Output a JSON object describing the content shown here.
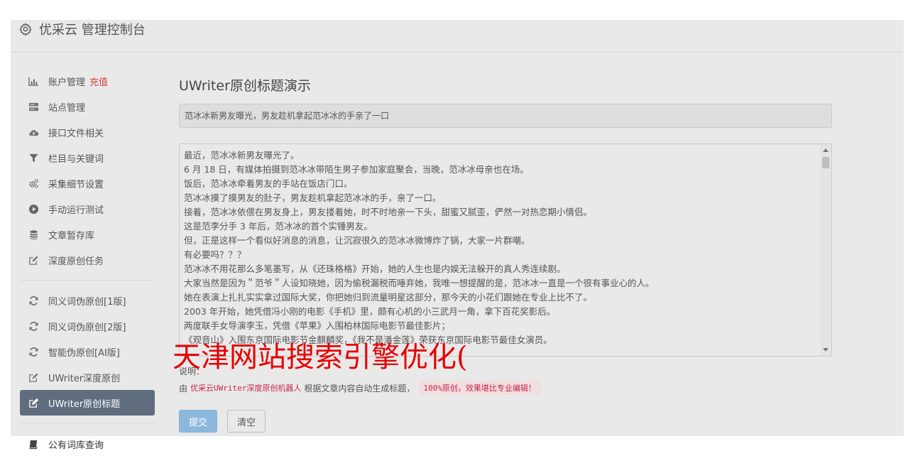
{
  "app": {
    "title": "优采云 管理控制台"
  },
  "sidebar": {
    "items": [
      {
        "label": "账户管理",
        "badge": "充值",
        "icon": "bar-chart-icon"
      },
      {
        "label": "站点管理",
        "icon": "server-icon"
      },
      {
        "label": "接口文件相关",
        "icon": "cloud-upload-icon"
      },
      {
        "label": "栏目与关键词",
        "icon": "filter-icon"
      },
      {
        "label": "采集细节设置",
        "icon": "gears-icon"
      },
      {
        "label": "手动运行测试",
        "icon": "play-circle-icon"
      },
      {
        "label": "文章暂存库",
        "icon": "database-icon"
      },
      {
        "label": "深度原创任务",
        "icon": "edit-icon"
      }
    ],
    "items2": [
      {
        "label": "同义词伪原创[1版]",
        "icon": "refresh-icon"
      },
      {
        "label": "同义词伪原创[2版]",
        "icon": "refresh-icon"
      },
      {
        "label": "智能伪原创[AI版]",
        "icon": "refresh-icon"
      },
      {
        "label": "UWriter深度原创",
        "icon": "edit-icon"
      },
      {
        "label": "UWriter原创标题",
        "icon": "edit-icon",
        "active": true
      }
    ],
    "below": {
      "label": "公有词库查询",
      "icon": "book-icon"
    }
  },
  "main": {
    "title": "UWriter原创标题演示",
    "title_input_value": "范冰冰新男友曝光，男友趁机拿起范冰冰的手亲了一口",
    "article_lines": [
      "最近，范冰冰新男友曝光了。",
      "6 月 18 日，有媒体拍摄到范冰冰带陌生男子参加家庭聚会，当晚，范冰冰母亲也在场。",
      "饭后，范冰冰牵着男友的手站在饭店门口。",
      "范冰冰摸了摸男友的肚子，男友趁机拿起范冰冰的手，亲了一口。",
      "接着，范冰冰依偎在男友身上，男友搂着她，时不时地亲一下头，甜蜜又腻歪，俨然一对热恋期小情侣。",
      "这是范李分手 3 年后，范冰冰的首个实锤男友。",
      "但，正是这样一个看似好消息的消息，让沉寂很久的范冰冰微博炸了锅，大家一片群嘲。",
      "有必要吗？？？",
      "范冰冰不用花那么多笔墨写，从《还珠格格》开始，她的人生也是内娱无法躲开的真人秀连续剧。",
      "大家当然是因为＂范爷＂人设知晓她，因为偷税漏税而唾弃她，我唯一想提醒的是，范冰冰一直是一个很有事业心的人。",
      "她在表演上扎扎实实拿过国际大奖，你把她归到流量明星这部分，那今天的小花们跟她在专业上比不了。",
      "2003 年开始，她凭借冯小刚的电影《手机》里，颇有心机的小三武月一角，拿下百花奖影后。",
      "两度联手女导演李玉，凭借《苹果》入围柏林国际电影节最佳影片；",
      "《观音山》入围东京国际电影节金麒麟奖，《我不是潘金莲》荣获东京国际电影节最佳女演员。"
    ],
    "note_label": "说明：",
    "note_prefix": "由",
    "note_link": "优采云UWriter深度原创机器人",
    "note_mid": "根据文章内容自动生成标题，",
    "note_code": "100%原创，效果堪比专业编辑！",
    "submit_label": "提交",
    "clear_label": "清空"
  },
  "overlay": {
    "text": "天津网站搜索引擎优化("
  }
}
